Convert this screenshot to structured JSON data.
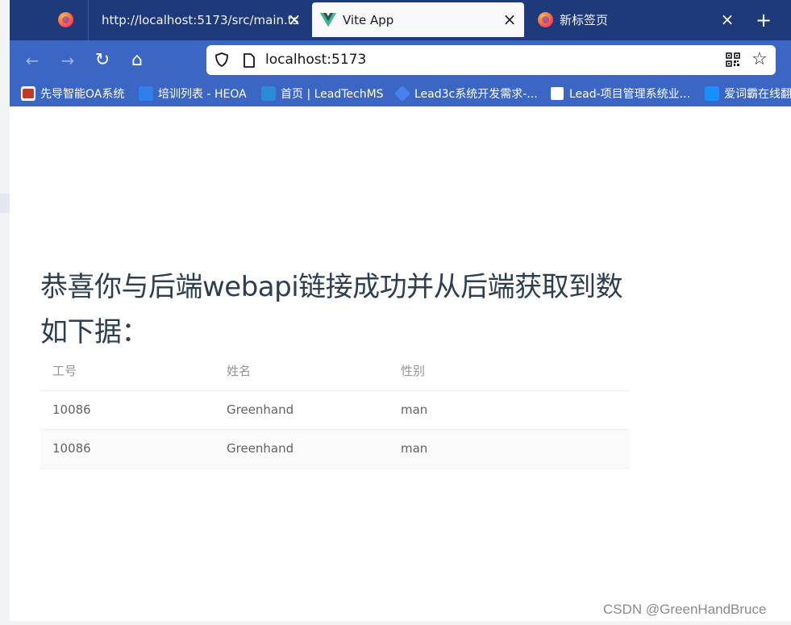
{
  "tabs": [
    {
      "label": "",
      "icon": "firefox-icon"
    },
    {
      "label": "http://localhost:5173/src/main.ts",
      "icon": "none"
    },
    {
      "label": "Vite App",
      "icon": "vue-icon",
      "active": true
    },
    {
      "label": "新标签页",
      "icon": "firefox-icon"
    }
  ],
  "tab_close_glyph": "×",
  "new_tab_glyph": "+",
  "nav": {
    "back": "←",
    "forward": "→",
    "reload": "↻",
    "home": "⌂",
    "url": "localhost:5173"
  },
  "bookmarks": [
    {
      "label": "先导智能OA系统",
      "icon_color": "#c0392b"
    },
    {
      "label": "培训列表 - HEOA",
      "icon_color": "#2f80ed"
    },
    {
      "label": "首页 | LeadTechMS",
      "icon_color": "#2a8bd8"
    },
    {
      "label": "Lead3c系统开发需求-...",
      "icon_color": "#4a7ff0"
    },
    {
      "label": "Lead-项目管理系统业...",
      "icon_color": "#ffffff"
    },
    {
      "label": "爱词霸在线翻",
      "icon_color": "#1890ff"
    }
  ],
  "page": {
    "heading": "恭喜你与后端webapi链接成功并从后端获取到数如下据：",
    "table": {
      "columns": [
        "工号",
        "姓名",
        "性别"
      ],
      "rows": [
        [
          "10086",
          "Greenhand",
          "man"
        ],
        [
          "10086",
          "Greenhand",
          "man"
        ]
      ]
    }
  },
  "watermark": "CSDN @GreenHandBruce",
  "colors": {
    "tabbar": "#1e3a7a",
    "toolbar": "#3c66c4",
    "heading": "#2c3e50"
  }
}
